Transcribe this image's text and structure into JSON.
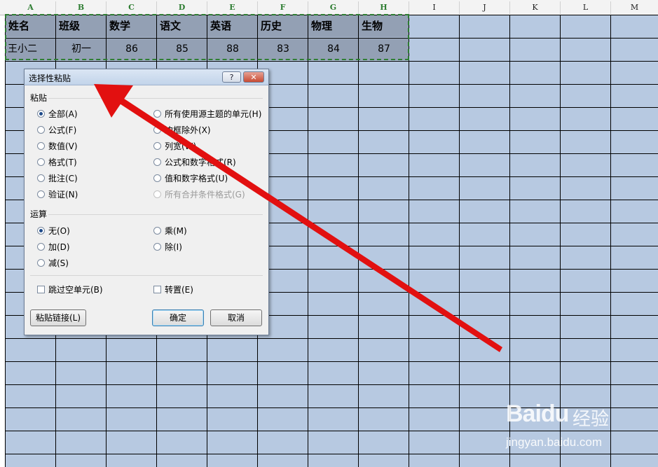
{
  "sheet": {
    "columns": [
      "A",
      "B",
      "C",
      "D",
      "E",
      "F",
      "G",
      "H",
      "I",
      "J",
      "K",
      "L",
      "M"
    ],
    "header_row": [
      "姓名",
      "班级",
      "数学",
      "语文",
      "英语",
      "历史",
      "物理",
      "生物"
    ],
    "data_row": [
      "王小二",
      "初一",
      "86",
      "85",
      "88",
      "83",
      "84",
      "87"
    ]
  },
  "dialog": {
    "title": "选择性粘贴",
    "help_label": "?",
    "close_label": "✕",
    "paste_group": "粘贴",
    "paste_options": [
      {
        "label": "全部(A)",
        "selected": true
      },
      {
        "label": "公式(F)",
        "selected": false
      },
      {
        "label": "数值(V)",
        "selected": false
      },
      {
        "label": "格式(T)",
        "selected": false
      },
      {
        "label": "批注(C)",
        "selected": false
      },
      {
        "label": "验证(N)",
        "selected": false
      },
      {
        "label": "所有使用源主题的单元(H)",
        "selected": false
      },
      {
        "label": "边框除外(X)",
        "selected": false
      },
      {
        "label": "列宽(W)",
        "selected": false
      },
      {
        "label": "公式和数字格式(R)",
        "selected": false
      },
      {
        "label": "值和数字格式(U)",
        "selected": false
      },
      {
        "label": "所有合并条件格式(G)",
        "selected": false,
        "disabled": true
      }
    ],
    "operation_group": "运算",
    "operation_options": [
      {
        "label": "无(O)",
        "selected": true
      },
      {
        "label": "加(D)",
        "selected": false
      },
      {
        "label": "减(S)",
        "selected": false
      },
      {
        "label": "乘(M)",
        "selected": false
      },
      {
        "label": "除(I)",
        "selected": false
      }
    ],
    "skip_blanks": "跳过空单元(B)",
    "transpose": "转置(E)",
    "paste_link": "粘贴链接(L)",
    "ok": "确定",
    "cancel": "取消"
  },
  "watermark": {
    "logo": "Baidu",
    "logo_cn": "经验",
    "url": "jingyan.baidu.com"
  },
  "colors": {
    "grid_fill": "#b7c9e1",
    "table_fill": "#93a0b4",
    "copy_border": "#2e7d32",
    "arrow": "#e21010"
  }
}
